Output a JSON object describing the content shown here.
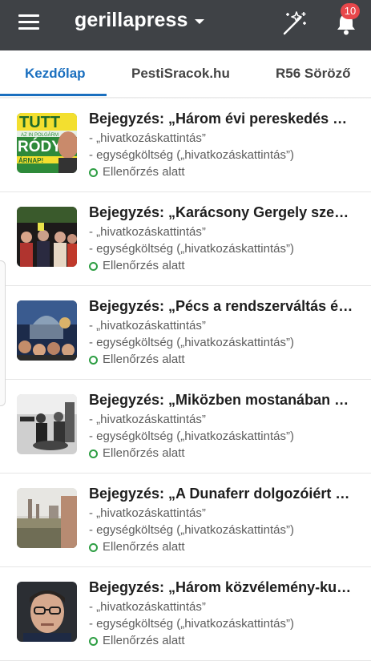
{
  "app": {
    "title": "gerillapress",
    "notification_count": "10",
    "colors": {
      "topbar": "#3f4246",
      "accent": "#1a6fbf",
      "badge": "#e8474b",
      "status": "#2e9e44"
    },
    "icons": [
      "menu-icon",
      "caret-down-icon",
      "magic-wand-icon",
      "bell-icon"
    ]
  },
  "tabs": [
    {
      "label": "Kezdőlap",
      "active": true
    },
    {
      "label": "PestiSracok.hu",
      "active": false
    },
    {
      "label": "R56 Söröző",
      "active": false
    }
  ],
  "posts": [
    {
      "title": "Bejegyzés: „Három évi pereskedés ut…",
      "line1": "- „hivatkozáskattintás”",
      "line2": "- egységköltség („hivatkozáskattintás”)",
      "status": "Ellenőrzés alatt"
    },
    {
      "title": "Bejegyzés: „Karácsony Gergely szere…",
      "line1": "- „hivatkozáskattintás”",
      "line2": "- egységköltség („hivatkozáskattintás”)",
      "status": "Ellenőrzés alatt"
    },
    {
      "title": "Bejegyzés: „Pécs a rendszerváltás és…",
      "line1": "- „hivatkozáskattintás”",
      "line2": "- egységköltség („hivatkozáskattintás”)",
      "status": "Ellenőrzés alatt"
    },
    {
      "title": "Bejegyzés: „Miközben mostanában K…",
      "line1": "- „hivatkozáskattintás”",
      "line2": "- egységköltség („hivatkozáskattintás”)",
      "status": "Ellenőrzés alatt"
    },
    {
      "title": "Bejegyzés: „A Dunaferr dolgozóiért a…",
      "line1": "- „hivatkozáskattintás”",
      "line2": "- egységköltség („hivatkozáskattintás”)",
      "status": "Ellenőrzés alatt"
    },
    {
      "title": "Bejegyzés: „Három közvélemény-kut…",
      "line1": "- „hivatkozáskattintás”",
      "line2": "- egységköltség („hivatkozáskattintás”)",
      "status": "Ellenőrzés alatt"
    }
  ],
  "thumb1": {
    "t1": "TUTT",
    "t2": "AZ IN POLGÁRM",
    "t3": "RÓDY",
    "t4": "ÁRNAP!"
  }
}
